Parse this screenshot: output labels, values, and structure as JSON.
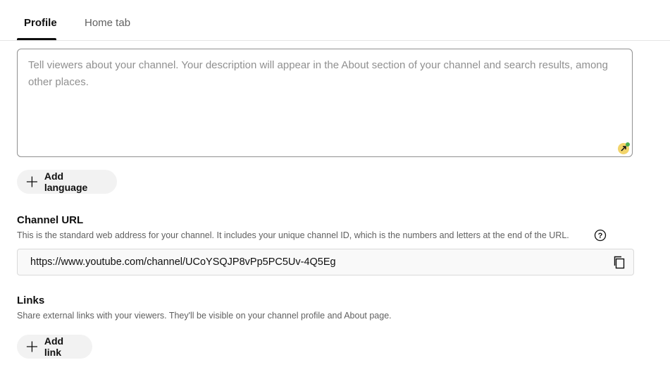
{
  "tabs": [
    {
      "label": "Profile",
      "active": true
    },
    {
      "label": "Home tab",
      "active": false
    }
  ],
  "description": {
    "placeholder": "Tell viewers about your channel. Your description will appear in the About section of your channel and search results, among other places.",
    "value": ""
  },
  "buttons": {
    "add_language": "Add language",
    "add_link": "Add link"
  },
  "channel_url": {
    "title": "Channel URL",
    "description": "This is the standard web address for your channel. It includes your unique channel ID, which is the numbers and letters at the end of the URL.",
    "value": "https://www.youtube.com/channel/UCoYSQJP8vPp5PC5Uv-4Q5Eg"
  },
  "links": {
    "title": "Links",
    "description": "Share external links with your viewers. They'll be visible on your channel profile and About page."
  },
  "icons": {
    "plus": "plus-icon",
    "help": "help-circle-icon",
    "copy": "copy-icon",
    "resize": "resize-handle-icon"
  },
  "colors": {
    "text_primary": "#0f0f0f",
    "text_secondary": "#606060",
    "placeholder": "#909090",
    "button_bg": "#f2f2f2",
    "border": "#909090"
  }
}
